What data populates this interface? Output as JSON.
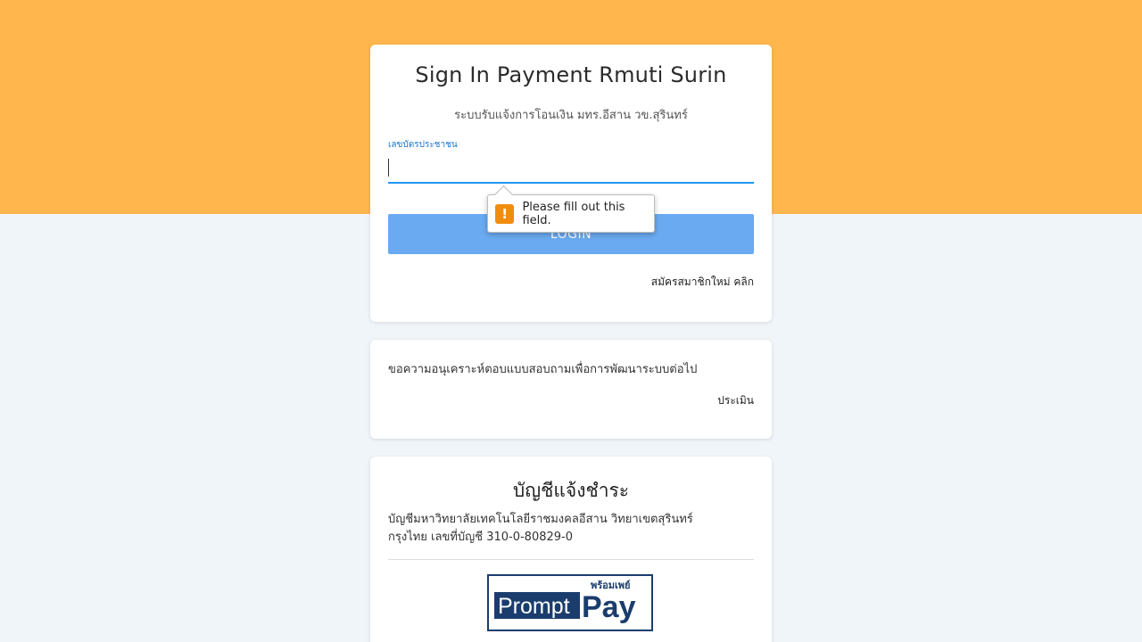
{
  "login_card": {
    "title": "Sign In Payment Rmuti Surin",
    "subtitle": "ระบบรับแจ้งการโอนเงิน มทร.อีสาน วข.สุรินทร์",
    "id_field": {
      "label": "เลขบัตรประชาชน",
      "value": "",
      "placeholder": ""
    },
    "login_button_label": "LOGIN",
    "register_link_label": "สมัครสมาชิกใหม่ คลิก"
  },
  "validation_tooltip": {
    "message": "Please fill out this field.",
    "icon": "exclamation-icon"
  },
  "survey_card": {
    "text": "ขอความอนุเคราะห์ตอบแบบสอบถามเพื่อการพัฒนาระบบต่อไป",
    "link_label": "ประเมิน"
  },
  "account_card": {
    "title": "บัญชีแจ้งชำระ",
    "account_name": "บัญชีมหาวิทยาลัยเทคโนโลยีราชมงคลอีสาน วิทยาเขตสุรินทร์",
    "bank_line": "กรุงไทย เลขที่บัญชี 310-0-80829-0"
  },
  "promptpay_logo": {
    "thai_text": "พร้อมเพย์",
    "prompt_text": "Prompt",
    "pay_text": "Pay"
  },
  "colors": {
    "header_band": "#ffb74d",
    "page_background": "#f0f5f9",
    "accent_blue": "#2196f3",
    "button_blue": "#6aaaf0",
    "warning_orange": "#f28c0f",
    "promptpay_navy": "#1b3d6d"
  }
}
